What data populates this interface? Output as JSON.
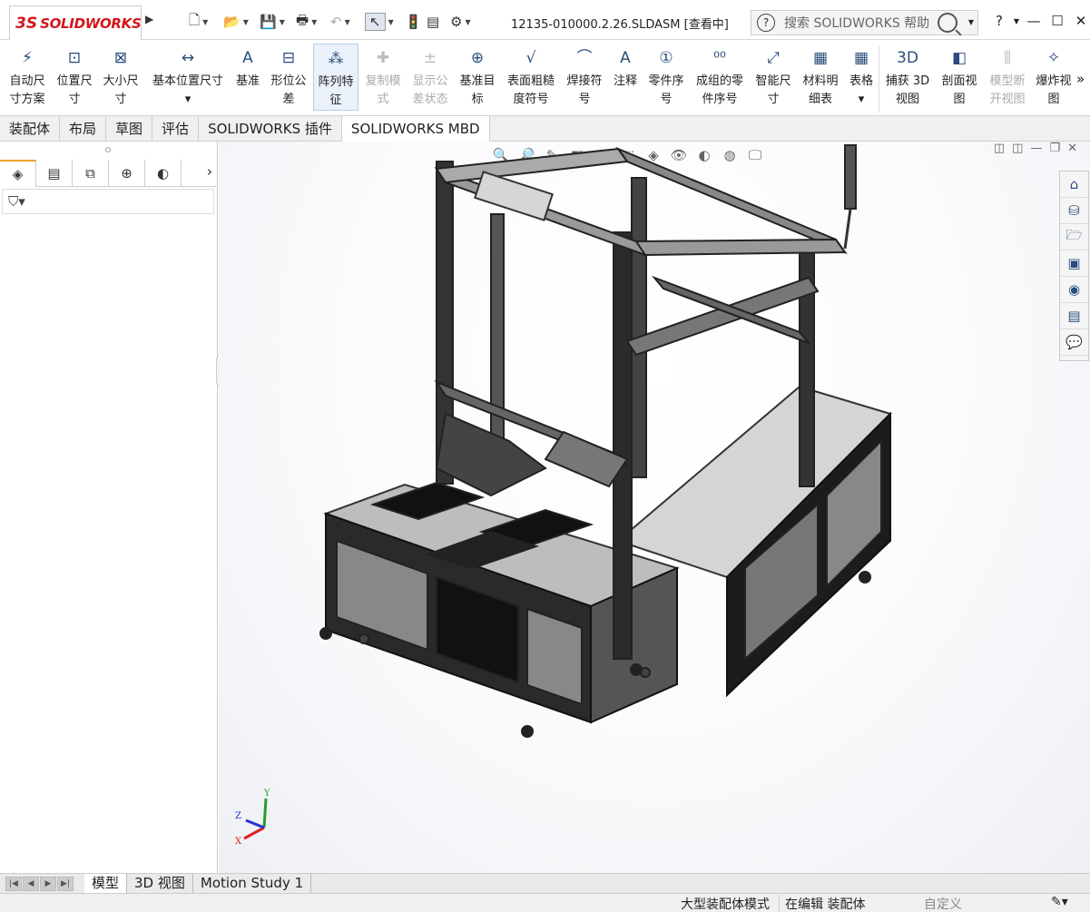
{
  "app": {
    "brand_prefix": "3S",
    "brand": "SOLIDWORKS"
  },
  "quick_access": [
    {
      "name": "new",
      "glyph": "🗋"
    },
    {
      "name": "open",
      "glyph": "📂"
    },
    {
      "name": "save",
      "glyph": "💾"
    },
    {
      "name": "print",
      "glyph": "🖶"
    },
    {
      "name": "undo",
      "glyph": "↶"
    },
    {
      "name": "select",
      "glyph": "↖"
    },
    {
      "name": "traffic-light",
      "glyph": "🚦"
    },
    {
      "name": "file-props",
      "glyph": "▤"
    },
    {
      "name": "options",
      "glyph": "⚙"
    }
  ],
  "document_title": "12135-010000.2.26.SLDASM [查看中]",
  "search": {
    "placeholder": "搜索 SOLIDWORKS 帮助"
  },
  "help_label": "?",
  "ribbon": [
    {
      "l1": "自动尺",
      "l2": "寸方案",
      "icon": "⚡",
      "disabled": false
    },
    {
      "l1": "位置尺",
      "l2": "寸",
      "icon": "⊡",
      "disabled": false
    },
    {
      "l1": "大小尺",
      "l2": "寸",
      "icon": "⊠",
      "disabled": false
    },
    {
      "l1": "基本位置尺寸",
      "l2": "▾",
      "icon": "↔",
      "disabled": false
    },
    {
      "l1": "基准",
      "l2": "",
      "icon": "A",
      "disabled": false
    },
    {
      "l1": "形位公",
      "l2": "差",
      "icon": "⊟",
      "disabled": false
    },
    {
      "l1": "阵列特",
      "l2": "征",
      "icon": "⁂",
      "disabled": false,
      "active": true
    },
    {
      "l1": "复制模",
      "l2": "式",
      "icon": "✚",
      "disabled": true
    },
    {
      "l1": "显示公",
      "l2": "差状态",
      "icon": "±",
      "disabled": true
    },
    {
      "l1": "基准目",
      "l2": "标",
      "icon": "⊕",
      "disabled": false
    },
    {
      "l1": "表面粗糙",
      "l2": "度符号",
      "icon": "√",
      "disabled": false
    },
    {
      "l1": "焊接符",
      "l2": "号",
      "icon": "⌒",
      "disabled": false
    },
    {
      "l1": "注释",
      "l2": "",
      "icon": "A",
      "disabled": false
    },
    {
      "l1": "零件序",
      "l2": "号",
      "icon": "①",
      "disabled": false
    },
    {
      "l1": "成组的零",
      "l2": "件序号",
      "icon": "⁰⁰",
      "disabled": false
    },
    {
      "l1": "智能尺",
      "l2": "寸",
      "icon": "⤢",
      "disabled": false
    },
    {
      "l1": "材料明",
      "l2": "细表",
      "icon": "▦",
      "disabled": false
    },
    {
      "l1": "表格",
      "l2": "▾",
      "icon": "▦",
      "disabled": false
    },
    {
      "l1": "捕获 3D",
      "l2": "视图",
      "icon": "3D",
      "disabled": false
    },
    {
      "l1": "剖面视",
      "l2": "图",
      "icon": "◧",
      "disabled": false
    },
    {
      "l1": "模型断",
      "l2": "开视图",
      "icon": "⫼",
      "disabled": true
    },
    {
      "l1": "爆炸视",
      "l2": "图",
      "icon": "✧",
      "disabled": false
    }
  ],
  "ribbon_more": "»",
  "cm_tabs": [
    "装配体",
    "布局",
    "草图",
    "评估",
    "SOLIDWORKS 插件",
    "SOLIDWORKS MBD"
  ],
  "cm_active": "SOLIDWORKS MBD",
  "left_tabs": [
    {
      "name": "feature-manager-tab",
      "glyph": "◈"
    },
    {
      "name": "property-manager-tab",
      "glyph": "▤"
    },
    {
      "name": "configuration-manager-tab",
      "glyph": "⧉"
    },
    {
      "name": "dimxpert-manager-tab",
      "glyph": "⊕"
    },
    {
      "name": "display-manager-tab",
      "glyph": "◐"
    }
  ],
  "filter_glyph": "⛉▾",
  "task_pane": [
    {
      "name": "home",
      "glyph": "⌂"
    },
    {
      "name": "design-library",
      "glyph": "⛁"
    },
    {
      "name": "file-explorer",
      "glyph": "🗁"
    },
    {
      "name": "view-palette",
      "glyph": "▣"
    },
    {
      "name": "appearances",
      "glyph": "◉"
    },
    {
      "name": "custom-properties",
      "glyph": "▤"
    },
    {
      "name": "forum",
      "glyph": "💬"
    }
  ],
  "triad": {
    "x": "X",
    "y": "Y",
    "z": "Z"
  },
  "bottom_tabs": [
    "模型",
    "3D 视图",
    "Motion Study 1"
  ],
  "bottom_active": "模型",
  "status": {
    "mode": "大型装配体模式",
    "editing": "在编辑 装配体",
    "custom": "自定义"
  }
}
